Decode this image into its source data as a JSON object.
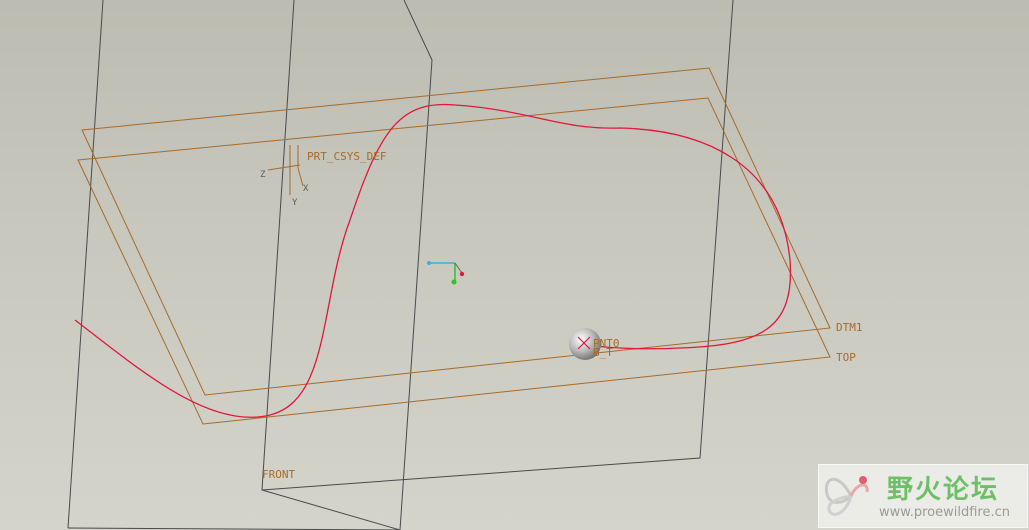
{
  "viewport": {
    "labels": {
      "csys": "PRT_CSYS_DEF",
      "csys_z": "Z",
      "csys_x": "X",
      "csys_y": "Y",
      "dtm1": "DTM1",
      "top": "TOP",
      "front": "FRONT",
      "pnt0": "PNT0",
      "pnt_sub": "B_T"
    },
    "colors": {
      "datum_plane": "#a86a2a",
      "front_plane": "#4a4a4a",
      "curve": "#e0183c",
      "triad_x": "#3ab0d8",
      "triad_y": "#30c030",
      "triad_z": "#e0183c"
    }
  },
  "watermark": {
    "title": "野火论坛",
    "url": "www.proewildfire.cn",
    "icon": "butterfly-logo-icon"
  }
}
